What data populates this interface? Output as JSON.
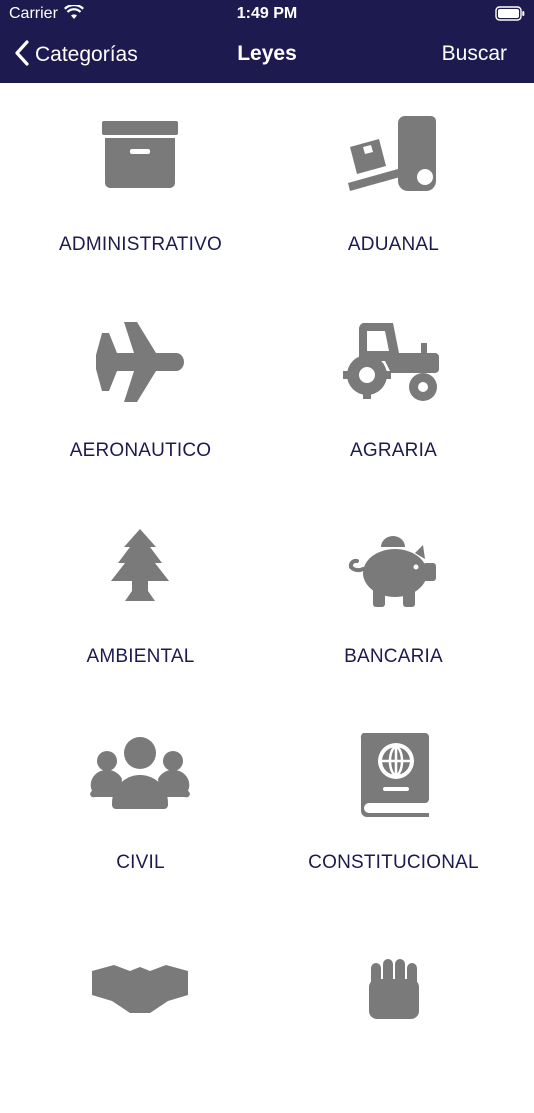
{
  "status_bar": {
    "carrier": "Carrier",
    "time": "1:49 PM"
  },
  "nav": {
    "back_label": "Categorías",
    "title": "Leyes",
    "search_label": "Buscar"
  },
  "colors": {
    "nav_background": "#1d1a4f",
    "label_color": "#1d1a4f",
    "icon_color": "#7a7a7a"
  },
  "categories": [
    {
      "label": "ADMINISTRATIVO",
      "icon": "archive-box-icon"
    },
    {
      "label": "ADUANAL",
      "icon": "hand-truck-icon"
    },
    {
      "label": "AERONAUTICO",
      "icon": "airplane-icon"
    },
    {
      "label": "AGRARIA",
      "icon": "tractor-icon"
    },
    {
      "label": "AMBIENTAL",
      "icon": "tree-icon"
    },
    {
      "label": "BANCARIA",
      "icon": "piggy-bank-icon"
    },
    {
      "label": "CIVIL",
      "icon": "users-icon"
    },
    {
      "label": "CONSTITUCIONAL",
      "icon": "passport-icon"
    },
    {
      "label": "",
      "icon": "handshake-icon"
    },
    {
      "label": "",
      "icon": "fist-icon"
    }
  ]
}
